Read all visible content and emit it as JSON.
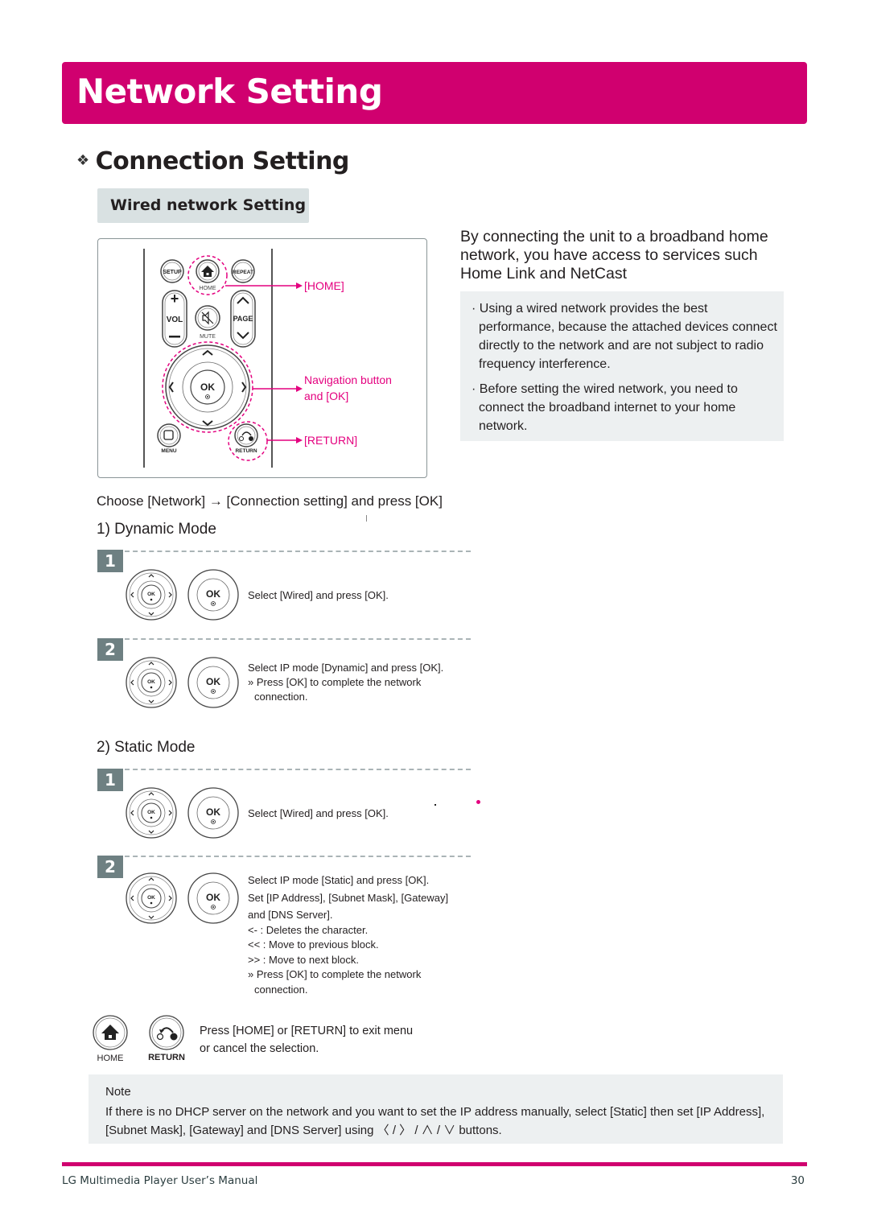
{
  "header": {
    "title": "Network Setting"
  },
  "section": {
    "title": "Connection Setting",
    "bullet_icon": "diamond-cluster-icon"
  },
  "subtab": {
    "label": "Wired network Setting"
  },
  "remote_figure": {
    "buttons": {
      "setup": "SETUP",
      "home": "HOME",
      "repeat": "REPEAT",
      "vol": "VOL",
      "page": "PAGE",
      "mute": "MUTE",
      "ok": "OK",
      "menu": "MENU",
      "return": "RETURN",
      "plus": "+",
      "minus": "–"
    },
    "callouts": {
      "home": "[HOME]",
      "nav_line1": "Navigation button",
      "nav_line2": "and [OK]",
      "return": "[RETURN]"
    },
    "accent_color": "#e4007f"
  },
  "intro": {
    "text": "By connecting the unit to a broadband home network, you have access to services such Home Link and NetCast",
    "bullets": [
      "· Using a wired network provides the best performance, because the attached devices connect directly to the network and are not subject to radio frequency interference.",
      "· Before setting the wired network, you need to connect the broadband internet to your home network."
    ]
  },
  "choose_instruction": "Choose [Network] → [Connection setting] and press [OK]",
  "dynamic_mode": {
    "title": "1) Dynamic Mode",
    "steps": [
      {
        "number": "1",
        "lines": [
          "Select [Wired] and press [OK]."
        ]
      },
      {
        "number": "2",
        "lines": [
          "Select IP mode [Dynamic] and press [OK].",
          "» Press [OK] to complete the network",
          "connection."
        ]
      }
    ]
  },
  "static_mode": {
    "title": "2) Static Mode",
    "steps": [
      {
        "number": "1",
        "lines": [
          "Select [Wired] and press [OK]."
        ]
      },
      {
        "number": "2",
        "lines": [
          "Select IP mode [Static] and press [OK].",
          "Set [IP Address], [Subnet Mask], [Gateway]",
          "and [DNS Server].",
          "<- : Deletes the character.",
          "<< : Move to previous block.",
          ">> : Move to next block.",
          "» Press [OK] to complete the network",
          "connection."
        ]
      }
    ]
  },
  "exit": {
    "home_label": "HOME",
    "return_label": "RETURN",
    "line1": "Press [HOME] or [RETURN] to exit menu",
    "line2": "or cancel the selection."
  },
  "note": {
    "title": "Note",
    "body": "If there is no DHCP server on the network and you want to set the IP address manually, select [Static] then set [IP Address], [Subnet Mask], [Gateway] and [DNS Server] using 〈 / 〉 / ∧ / ∨ buttons."
  },
  "footer": {
    "manual_title": "LG Multimedia Player User’s Manual",
    "page_number": "30"
  },
  "colors": {
    "brand": "#d0006f",
    "badge": "#6e8082",
    "panel": "#edf0f1",
    "subtab": "#d9e1e2"
  }
}
